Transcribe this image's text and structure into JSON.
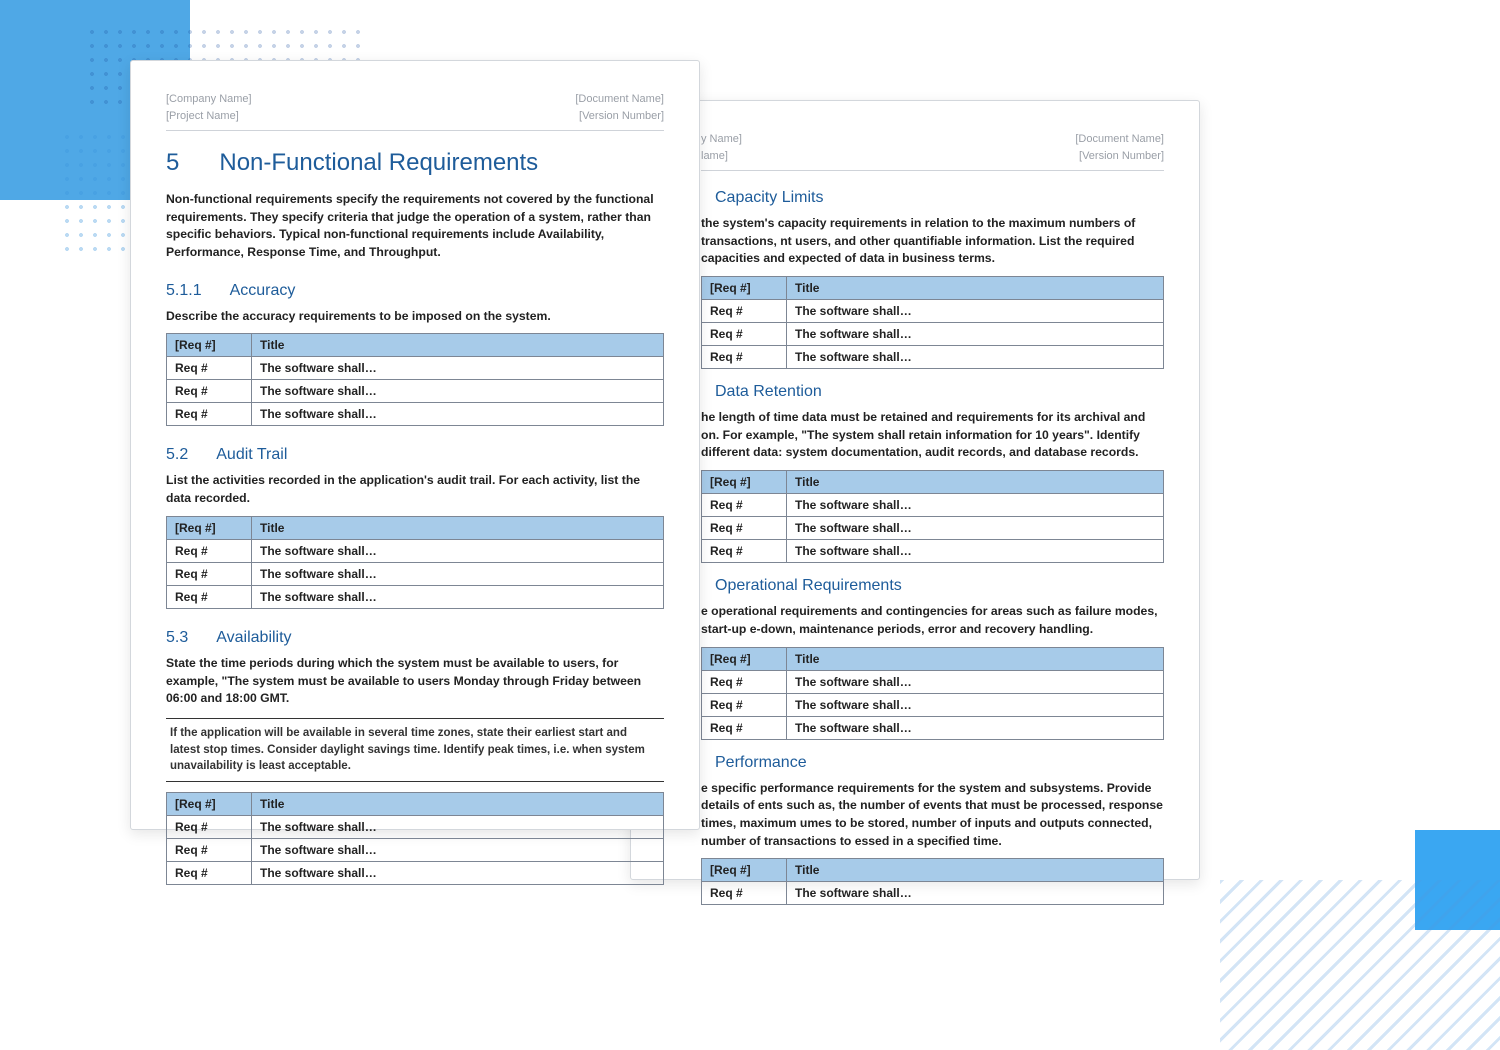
{
  "header": {
    "company": "[Company Name]",
    "project": "[Project Name]",
    "document": "[Document Name]",
    "version": "[Version Number]"
  },
  "header2": {
    "company_frag": "y Name]",
    "project_frag": "lame]",
    "document": "[Document Name]",
    "version": "[Version Number]"
  },
  "chapter": {
    "num": "5",
    "title": "Non-Functional Requirements"
  },
  "intro": "Non-functional requirements specify the requirements not covered by the functional requirements. They specify criteria that judge the operation of a system, rather than specific behaviors. Typical non-functional requirements include Availability, Performance, Response Time, and Throughput.",
  "table_head": {
    "c1": "[Req #]",
    "c2": "Title"
  },
  "row_placeholder": {
    "c1": "Req #",
    "c2": "The software shall…"
  },
  "sections_p1": [
    {
      "num": "5.1.1",
      "title": "Accuracy",
      "body": "Describe the accuracy requirements to be imposed on the system.",
      "rows": 3
    },
    {
      "num": "5.2",
      "title": "Audit Trail",
      "body": "List the activities recorded in the application's audit trail. For each activity, list the data recorded.",
      "rows": 3
    },
    {
      "num": "5.3",
      "title": "Availability",
      "body": "State the time periods during which the system must be available to users, for example, \"The system must be available to users Monday through Friday between 06:00 and 18:00 GMT.",
      "note": "If the application will be available in several time zones, state their earliest start and latest stop times. Consider daylight savings time. Identify peak times, i.e. when system unavailability is least acceptable.",
      "rows": 3
    }
  ],
  "sections_p2": [
    {
      "title": "Capacity Limits",
      "body": "the system's capacity requirements in relation to the maximum numbers of transactions, nt users, and other quantifiable information. List the required capacities and expected of data in business terms.",
      "rows": 3
    },
    {
      "title": "Data Retention",
      "body": "he length of time data must be retained and requirements for its archival and on. For example, \"The system shall retain information for 10 years\". Identify different data: system documentation, audit records, and database records.",
      "rows": 3
    },
    {
      "title": "Operational Requirements",
      "body": "e operational requirements and contingencies for areas such as failure modes, start-up e-down, maintenance periods, error and recovery handling.",
      "rows": 3
    },
    {
      "title": "Performance",
      "body": "e specific performance requirements for the system and subsystems. Provide details of ents such as, the number of events that must be processed, response times, maximum umes to be stored, number of inputs and outputs connected, number of transactions to essed in a specified time.",
      "rows": 1
    }
  ]
}
